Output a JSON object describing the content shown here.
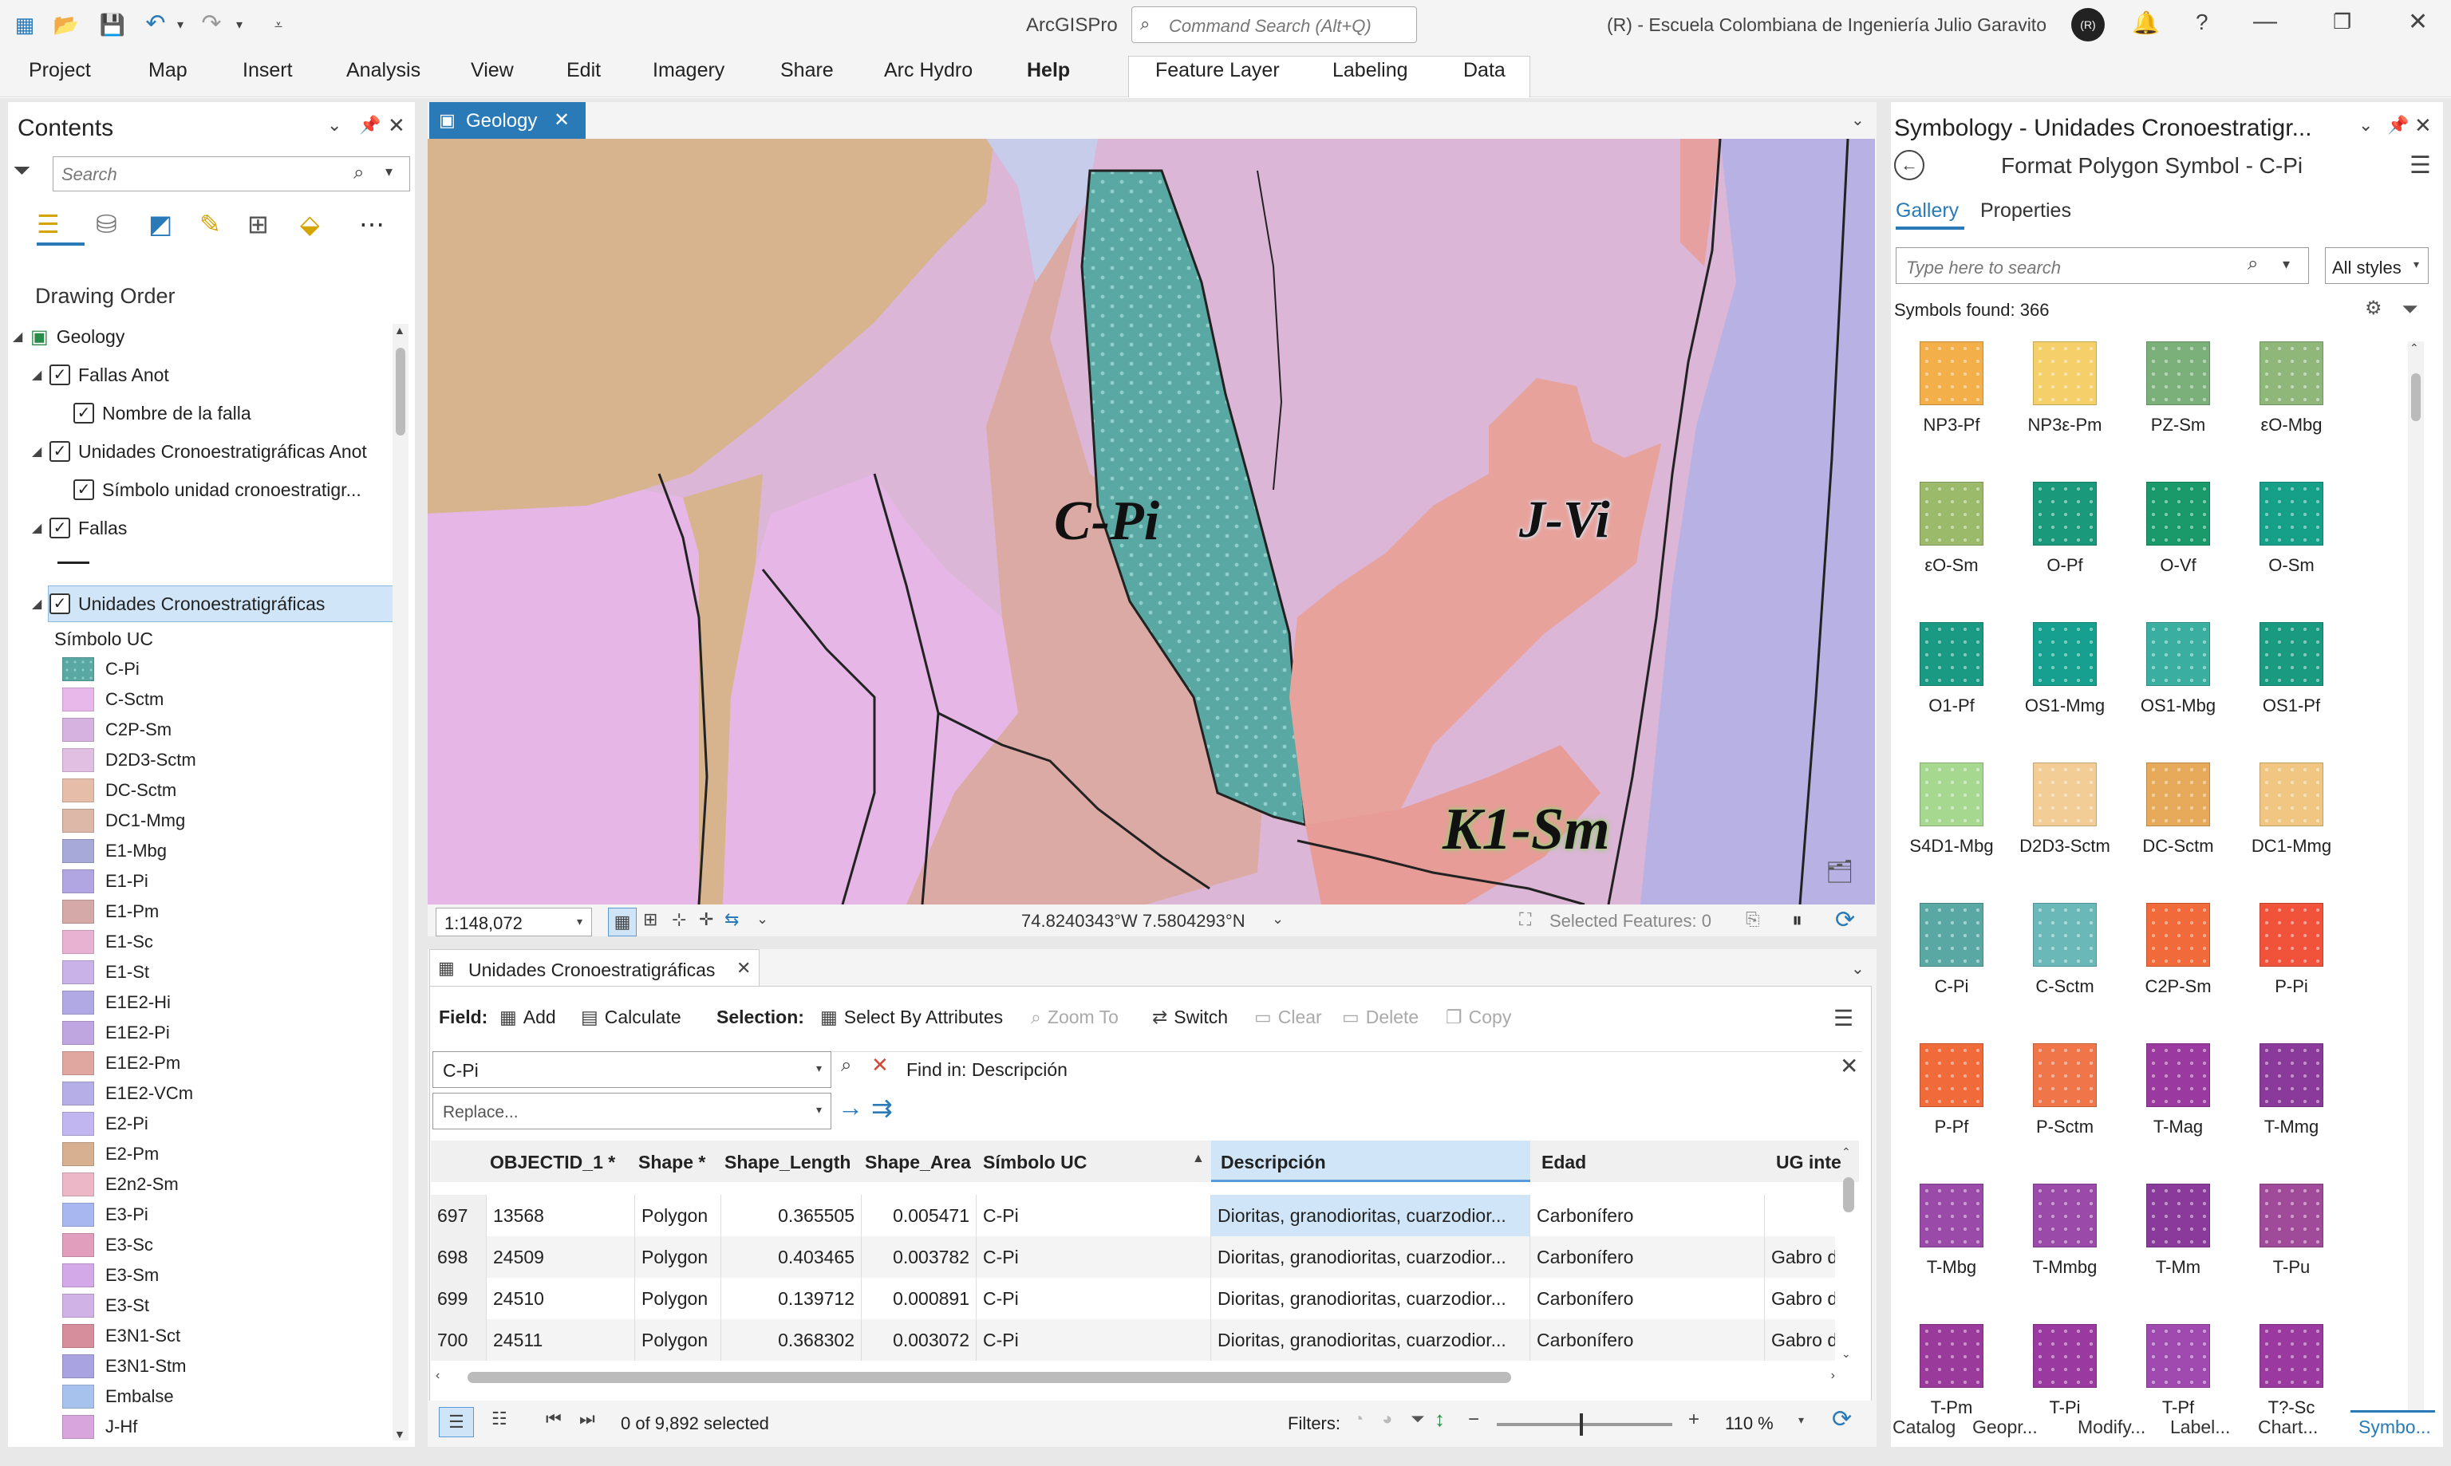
{
  "app": {
    "title": "ArcGISPro",
    "command_search": "Command Search (Alt+Q)",
    "user": "(R) - Escuela Colombiana de Ingeniería Julio Garavito",
    "avatar": "(R)"
  },
  "ribbon": {
    "tabs": [
      "Project",
      "Map",
      "Insert",
      "Analysis",
      "View",
      "Edit",
      "Imagery",
      "Share",
      "Arc Hydro",
      "Help"
    ],
    "context_tabs": [
      "Feature Layer",
      "Labeling",
      "Data"
    ]
  },
  "contents": {
    "title": "Contents",
    "search_placeholder": "Search",
    "drawing_order": "Drawing Order",
    "layers": [
      "Geology",
      "Fallas Anot",
      "Nombre de la falla",
      "Unidades Cronoestratigráficas Anot",
      "Símbolo unidad cronoestratigr...",
      "Fallas",
      "Unidades Cronoestratigráficas"
    ],
    "field_label": "Símbolo UC",
    "legend": [
      {
        "label": "C-Pi",
        "color": "#5aa8a3"
      },
      {
        "label": "C-Sctm",
        "color": "#e8b8ea"
      },
      {
        "label": "C2P-Sm",
        "color": "#d6b2e0"
      },
      {
        "label": "D2D3-Sctm",
        "color": "#e0bfe2"
      },
      {
        "label": "DC-Sctm",
        "color": "#e6bda8"
      },
      {
        "label": "DC1-Mmg",
        "color": "#ddb7a8"
      },
      {
        "label": "E1-Mbg",
        "color": "#a7a9d9"
      },
      {
        "label": "E1-Pi",
        "color": "#b2a6e2"
      },
      {
        "label": "E1-Pm",
        "color": "#d6a9a9"
      },
      {
        "label": "E1-Sc",
        "color": "#e8b2d2"
      },
      {
        "label": "E1-St",
        "color": "#c9b2e8"
      },
      {
        "label": "E1E2-Hi",
        "color": "#b0a9e4"
      },
      {
        "label": "E1E2-Pi",
        "color": "#c0a6e0"
      },
      {
        "label": "E1E2-Pm",
        "color": "#e0a6a0"
      },
      {
        "label": "E1E2-VCm",
        "color": "#b6aee6"
      },
      {
        "label": "E2-Pi",
        "color": "#c1b6ef"
      },
      {
        "label": "E2-Pm",
        "color": "#d6b090"
      },
      {
        "label": "E2n2-Sm",
        "color": "#ecb7c7"
      },
      {
        "label": "E3-Pi",
        "color": "#a9b7f0"
      },
      {
        "label": "E3-Sc",
        "color": "#e29ebd"
      },
      {
        "label": "E3-Sm",
        "color": "#d4a9e8"
      },
      {
        "label": "E3-St",
        "color": "#d0b2e6"
      },
      {
        "label": "E3N1-Sct",
        "color": "#d68e9c"
      },
      {
        "label": "E3N1-Stm",
        "color": "#a9a3e2"
      },
      {
        "label": "Embalse",
        "color": "#a8c2ee"
      },
      {
        "label": "J-Hf",
        "color": "#d8a6dc"
      }
    ]
  },
  "map": {
    "tab": "Geology",
    "labels": [
      "C-Pi",
      "J-Vi",
      "K1-Sm"
    ],
    "scale": "1:148,072",
    "coords": "74.8240343°W 7.5804293°N",
    "selected_features": "Selected Features: 0"
  },
  "table": {
    "tab": "Unidades Cronoestratigráficas",
    "field_label": "Field:",
    "add": "Add",
    "calculate": "Calculate",
    "selection_label": "Selection:",
    "select_by_attributes": "Select By Attributes",
    "zoom_to": "Zoom To",
    "switch": "Switch",
    "clear": "Clear",
    "delete": "Delete",
    "copy": "Copy",
    "find_value": "C-Pi",
    "find_in": "Find in: Descripción",
    "replace_placeholder": "Replace...",
    "columns": [
      "OBJECTID_1 *",
      "Shape *",
      "Shape_Length",
      "Shape_Area",
      "Símbolo UC",
      "Descripción",
      "Edad",
      "UG inte"
    ],
    "rows": [
      {
        "n": "697",
        "id": "13568",
        "shape": "Polygon",
        "len": "0.365505",
        "area": "0.005471",
        "sym": "C-Pi",
        "desc": "Dioritas, granodioritas, cuarzodior...",
        "edad": "Carbonífero",
        "ug": ""
      },
      {
        "n": "698",
        "id": "24509",
        "shape": "Polygon",
        "len": "0.403465",
        "area": "0.003782",
        "sym": "C-Pi",
        "desc": "Dioritas, granodioritas, cuarzodior...",
        "edad": "Carbonífero",
        "ug": "Gabro d"
      },
      {
        "n": "699",
        "id": "24510",
        "shape": "Polygon",
        "len": "0.139712",
        "area": "0.000891",
        "sym": "C-Pi",
        "desc": "Dioritas, granodioritas, cuarzodior...",
        "edad": "Carbonífero",
        "ug": "Gabro d"
      },
      {
        "n": "700",
        "id": "24511",
        "shape": "Polygon",
        "len": "0.368302",
        "area": "0.003072",
        "sym": "C-Pi",
        "desc": "Dioritas, granodioritas, cuarzodior...",
        "edad": "Carbonífero",
        "ug": "Gabro d"
      }
    ],
    "selected_count": "0 of 9,892 selected",
    "filters": "Filters:",
    "zoom": "110 %"
  },
  "symbology": {
    "title": "Symbology - Unidades Cronoestratigr...",
    "subtitle": "Format Polygon Symbol - C-Pi",
    "tab_gallery": "Gallery",
    "tab_properties": "Properties",
    "search_placeholder": "Type here to search",
    "styles": "All styles",
    "found": "Symbols found: 366",
    "symbols": [
      {
        "label": "NP3-Pf",
        "color": "#f3b04a"
      },
      {
        "label": "NP3ε-Pm",
        "color": "#f5d06a"
      },
      {
        "label": "PZ-Sm",
        "color": "#7bb07a"
      },
      {
        "label": "εO-Mbg",
        "color": "#8fb77a"
      },
      {
        "label": "εO-Sm",
        "color": "#9bbb6a"
      },
      {
        "label": "O-Pf",
        "color": "#1a9a7a"
      },
      {
        "label": "O-Vf",
        "color": "#1a9a6a"
      },
      {
        "label": "O-Sm",
        "color": "#16a08a"
      },
      {
        "label": "O1-Pf",
        "color": "#1a9a82"
      },
      {
        "label": "OS1-Mmg",
        "color": "#16a090"
      },
      {
        "label": "OS1-Mbg",
        "color": "#3aaea0"
      },
      {
        "label": "OS1-Pf",
        "color": "#1a9a80"
      },
      {
        "label": "S4D1-Mbg",
        "color": "#a6d890"
      },
      {
        "label": "D2D3-Sctm",
        "color": "#f2cd96"
      },
      {
        "label": "DC-Sctm",
        "color": "#e6aa5a"
      },
      {
        "label": "DC1-Mmg",
        "color": "#f0c682"
      },
      {
        "label": "C-Pi",
        "color": "#5aa8a3"
      },
      {
        "label": "C-Sctm",
        "color": "#6ab8b8"
      },
      {
        "label": "C2P-Sm",
        "color": "#f06a3a"
      },
      {
        "label": "P-Pi",
        "color": "#f0523a"
      },
      {
        "label": "P-Pf",
        "color": "#f06a3a"
      },
      {
        "label": "P-Sctm",
        "color": "#f0764a"
      },
      {
        "label": "T-Mag",
        "color": "#9a3aa0"
      },
      {
        "label": "T-Mmg",
        "color": "#8a3a9a"
      },
      {
        "label": "T-Mbg",
        "color": "#9a4aa8"
      },
      {
        "label": "T-Mmbg",
        "color": "#9a4aa8"
      },
      {
        "label": "T-Mm",
        "color": "#8a3a9a"
      },
      {
        "label": "T-Pu",
        "color": "#a04a9a"
      },
      {
        "label": "T-Pm",
        "color": "#9a3a9a"
      },
      {
        "label": "T-Pi",
        "color": "#9a3aa0"
      },
      {
        "label": "T-Pf",
        "color": "#a04ab0"
      },
      {
        "label": "T?-Sc",
        "color": "#9a3aa0"
      }
    ]
  },
  "bottom_tabs": [
    "Catalog",
    "Geopr...",
    "Modify...",
    "Label...",
    "Chart...",
    "Symbo..."
  ]
}
